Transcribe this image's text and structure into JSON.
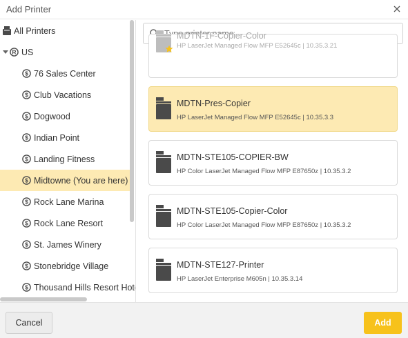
{
  "dialog": {
    "title": "Add Printer",
    "close_icon": "close-icon"
  },
  "tree": {
    "all_printers": {
      "label": "All Printers",
      "icon": "printer-icon"
    },
    "region": {
      "label": "US",
      "icon": "registered-icon",
      "expanded": true
    },
    "locations": [
      {
        "label": "76 Sales Center",
        "icon": "dollar-circle-icon",
        "selected": false
      },
      {
        "label": "Club Vacations",
        "icon": "dollar-circle-icon",
        "selected": false
      },
      {
        "label": "Dogwood",
        "icon": "dollar-circle-icon",
        "selected": false
      },
      {
        "label": "Indian Point",
        "icon": "dollar-circle-icon",
        "selected": false
      },
      {
        "label": "Landing Fitness",
        "icon": "dollar-circle-icon",
        "selected": false
      },
      {
        "label": "Midtowne (You are here)",
        "icon": "dollar-circle-icon",
        "selected": true
      },
      {
        "label": "Rock Lane Marina",
        "icon": "dollar-circle-icon",
        "selected": false
      },
      {
        "label": "Rock Lane Resort",
        "icon": "dollar-circle-icon",
        "selected": false
      },
      {
        "label": "St. James Winery",
        "icon": "dollar-circle-icon",
        "selected": false
      },
      {
        "label": "Stonebridge Village",
        "icon": "dollar-circle-icon",
        "selected": false
      },
      {
        "label": "Thousand Hills Resort Hotel",
        "icon": "dollar-circle-icon",
        "selected": false
      }
    ]
  },
  "search": {
    "placeholder": "Type printer name",
    "value": ""
  },
  "printers": [
    {
      "name": "MDTN-1F-Copier-Color",
      "detail": "HP LaserJet Managed Flow MFP E52645c | 10.35.3.21",
      "favorite": true,
      "selected": false,
      "faded": true
    },
    {
      "name": "MDTN-Pres-Copier",
      "detail": "HP LaserJet Managed Flow MFP E52645c | 10.35.3.3",
      "favorite": false,
      "selected": true,
      "faded": false
    },
    {
      "name": "MDTN-STE105-COPIER-BW",
      "detail": "HP Color LaserJet Managed Flow MFP E87650z | 10.35.3.2",
      "favorite": false,
      "selected": false,
      "faded": false
    },
    {
      "name": "MDTN-STE105-Copier-Color",
      "detail": "HP Color LaserJet Managed Flow MFP E87650z | 10.35.3.2",
      "favorite": false,
      "selected": false,
      "faded": false
    },
    {
      "name": "MDTN-STE127-Printer",
      "detail": "HP LaserJet Enterprise M605n | 10.35.3.14",
      "favorite": false,
      "selected": false,
      "faded": false
    }
  ],
  "footer": {
    "cancel_label": "Cancel",
    "add_label": "Add"
  },
  "colors": {
    "selected_bg": "#fdeab3",
    "accent": "#f7c21b",
    "icon_dark": "#4a4a4a"
  }
}
